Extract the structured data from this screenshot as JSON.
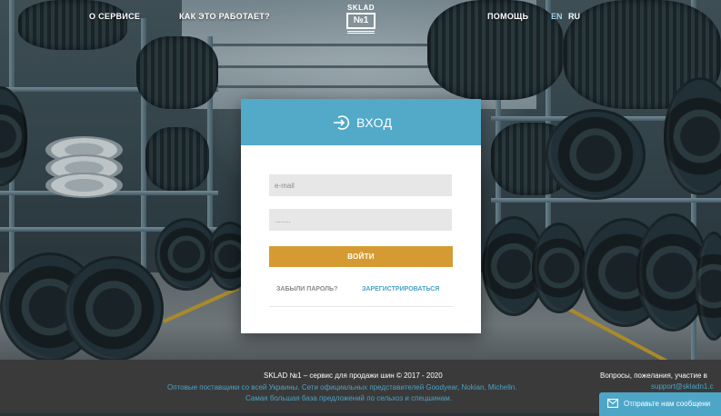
{
  "header": {
    "nav": {
      "about": "О СЕРВИСЕ",
      "how_it_works": "КАК ЭТО РАБОТАЕТ?",
      "help": "ПОМОЩЬ"
    },
    "logo": {
      "top": "SKLAD",
      "mark": "№1"
    },
    "languages": {
      "en": "EN",
      "ru": "RU",
      "active": "EN"
    }
  },
  "login": {
    "title": "ВХОД",
    "email_placeholder": "e-mail",
    "password_placeholder": "........",
    "submit_label": "ВОЙТИ",
    "forgot_label": "ЗАБЫЛИ ПАРОЛЬ?",
    "register_label": "ЗАРЕГИСТРИРОВАТЬСЯ"
  },
  "footer": {
    "main": "SKLAD №1 – сервис для продажи шин © 2017 - 2020",
    "line1": "Оптовые поставщики со всей Украины. Сети официальных представителей Goodyear, Nokian, Michelin.",
    "line2": "Самая большая база предложений по сельхоз и спецшинам.",
    "contact": "Вопросы, пожелания, участие в",
    "email": "support@skladn1.c",
    "chat_label": "Отправьте нам сообщени"
  },
  "colors": {
    "accent_blue": "#52a9c8",
    "button_gold": "#d59b32",
    "footer_bg": "#3a3a3a",
    "link_blue": "#4aa3c6"
  },
  "icons": {
    "login": "login-arrow-icon",
    "chat": "envelope-icon"
  }
}
